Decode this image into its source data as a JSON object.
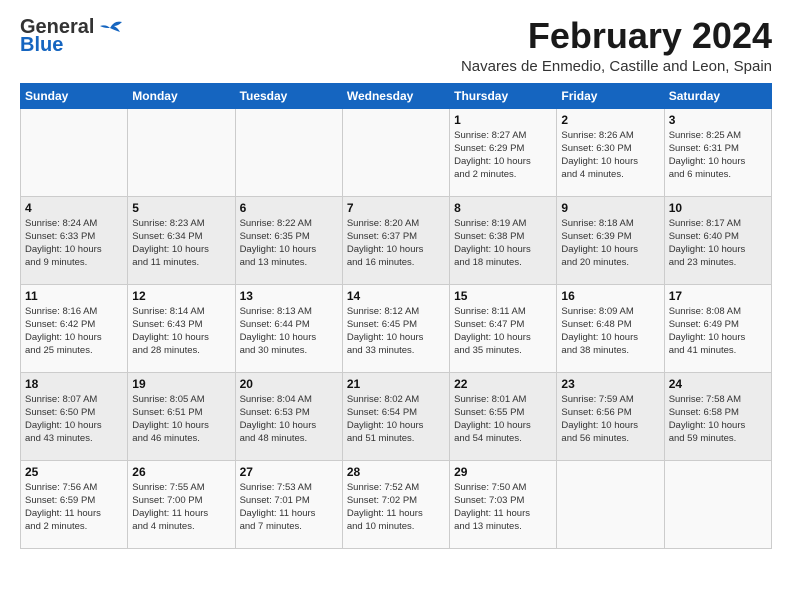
{
  "header": {
    "logo_general": "General",
    "logo_blue": "Blue",
    "title": "February 2024",
    "subtitle": "Navares de Enmedio, Castille and Leon, Spain"
  },
  "days_of_week": [
    "Sunday",
    "Monday",
    "Tuesday",
    "Wednesday",
    "Thursday",
    "Friday",
    "Saturday"
  ],
  "weeks": [
    [
      {
        "day": "",
        "info": ""
      },
      {
        "day": "",
        "info": ""
      },
      {
        "day": "",
        "info": ""
      },
      {
        "day": "",
        "info": ""
      },
      {
        "day": "1",
        "info": "Sunrise: 8:27 AM\nSunset: 6:29 PM\nDaylight: 10 hours\nand 2 minutes."
      },
      {
        "day": "2",
        "info": "Sunrise: 8:26 AM\nSunset: 6:30 PM\nDaylight: 10 hours\nand 4 minutes."
      },
      {
        "day": "3",
        "info": "Sunrise: 8:25 AM\nSunset: 6:31 PM\nDaylight: 10 hours\nand 6 minutes."
      }
    ],
    [
      {
        "day": "4",
        "info": "Sunrise: 8:24 AM\nSunset: 6:33 PM\nDaylight: 10 hours\nand 9 minutes."
      },
      {
        "day": "5",
        "info": "Sunrise: 8:23 AM\nSunset: 6:34 PM\nDaylight: 10 hours\nand 11 minutes."
      },
      {
        "day": "6",
        "info": "Sunrise: 8:22 AM\nSunset: 6:35 PM\nDaylight: 10 hours\nand 13 minutes."
      },
      {
        "day": "7",
        "info": "Sunrise: 8:20 AM\nSunset: 6:37 PM\nDaylight: 10 hours\nand 16 minutes."
      },
      {
        "day": "8",
        "info": "Sunrise: 8:19 AM\nSunset: 6:38 PM\nDaylight: 10 hours\nand 18 minutes."
      },
      {
        "day": "9",
        "info": "Sunrise: 8:18 AM\nSunset: 6:39 PM\nDaylight: 10 hours\nand 20 minutes."
      },
      {
        "day": "10",
        "info": "Sunrise: 8:17 AM\nSunset: 6:40 PM\nDaylight: 10 hours\nand 23 minutes."
      }
    ],
    [
      {
        "day": "11",
        "info": "Sunrise: 8:16 AM\nSunset: 6:42 PM\nDaylight: 10 hours\nand 25 minutes."
      },
      {
        "day": "12",
        "info": "Sunrise: 8:14 AM\nSunset: 6:43 PM\nDaylight: 10 hours\nand 28 minutes."
      },
      {
        "day": "13",
        "info": "Sunrise: 8:13 AM\nSunset: 6:44 PM\nDaylight: 10 hours\nand 30 minutes."
      },
      {
        "day": "14",
        "info": "Sunrise: 8:12 AM\nSunset: 6:45 PM\nDaylight: 10 hours\nand 33 minutes."
      },
      {
        "day": "15",
        "info": "Sunrise: 8:11 AM\nSunset: 6:47 PM\nDaylight: 10 hours\nand 35 minutes."
      },
      {
        "day": "16",
        "info": "Sunrise: 8:09 AM\nSunset: 6:48 PM\nDaylight: 10 hours\nand 38 minutes."
      },
      {
        "day": "17",
        "info": "Sunrise: 8:08 AM\nSunset: 6:49 PM\nDaylight: 10 hours\nand 41 minutes."
      }
    ],
    [
      {
        "day": "18",
        "info": "Sunrise: 8:07 AM\nSunset: 6:50 PM\nDaylight: 10 hours\nand 43 minutes."
      },
      {
        "day": "19",
        "info": "Sunrise: 8:05 AM\nSunset: 6:51 PM\nDaylight: 10 hours\nand 46 minutes."
      },
      {
        "day": "20",
        "info": "Sunrise: 8:04 AM\nSunset: 6:53 PM\nDaylight: 10 hours\nand 48 minutes."
      },
      {
        "day": "21",
        "info": "Sunrise: 8:02 AM\nSunset: 6:54 PM\nDaylight: 10 hours\nand 51 minutes."
      },
      {
        "day": "22",
        "info": "Sunrise: 8:01 AM\nSunset: 6:55 PM\nDaylight: 10 hours\nand 54 minutes."
      },
      {
        "day": "23",
        "info": "Sunrise: 7:59 AM\nSunset: 6:56 PM\nDaylight: 10 hours\nand 56 minutes."
      },
      {
        "day": "24",
        "info": "Sunrise: 7:58 AM\nSunset: 6:58 PM\nDaylight: 10 hours\nand 59 minutes."
      }
    ],
    [
      {
        "day": "25",
        "info": "Sunrise: 7:56 AM\nSunset: 6:59 PM\nDaylight: 11 hours\nand 2 minutes."
      },
      {
        "day": "26",
        "info": "Sunrise: 7:55 AM\nSunset: 7:00 PM\nDaylight: 11 hours\nand 4 minutes."
      },
      {
        "day": "27",
        "info": "Sunrise: 7:53 AM\nSunset: 7:01 PM\nDaylight: 11 hours\nand 7 minutes."
      },
      {
        "day": "28",
        "info": "Sunrise: 7:52 AM\nSunset: 7:02 PM\nDaylight: 11 hours\nand 10 minutes."
      },
      {
        "day": "29",
        "info": "Sunrise: 7:50 AM\nSunset: 7:03 PM\nDaylight: 11 hours\nand 13 minutes."
      },
      {
        "day": "",
        "info": ""
      },
      {
        "day": "",
        "info": ""
      }
    ]
  ]
}
